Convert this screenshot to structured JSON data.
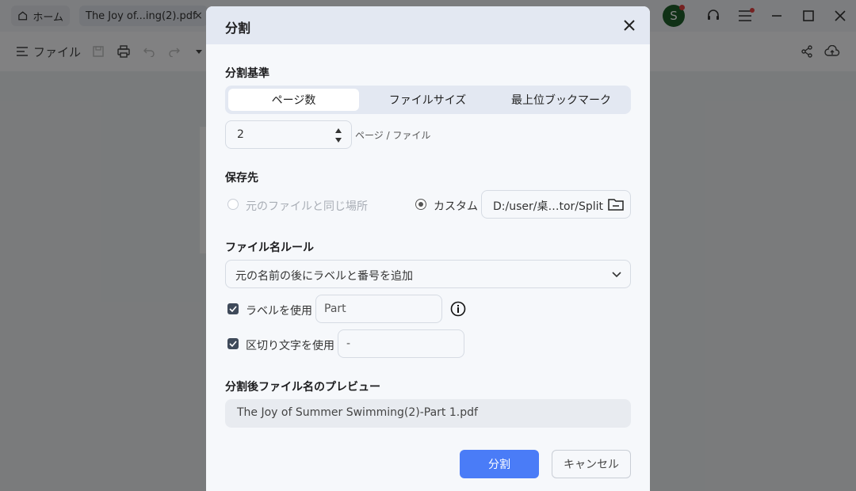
{
  "app": {
    "tabs": [
      {
        "label": "ホーム",
        "icon": "home-icon"
      },
      {
        "label": "The Joy of...ing(2).pdf",
        "icon": "close-icon"
      }
    ],
    "avatar_letter": "S",
    "toolbar": {
      "file_label": "ファイル"
    },
    "colors": {
      "avatar": "#1f5f2b",
      "notification": "#e04040"
    }
  },
  "dialog": {
    "title": "分割",
    "split_criteria": {
      "label": "分割基準",
      "options": [
        "ページ数",
        "ファイルサイズ",
        "最上位ブックマーク"
      ],
      "selected": "ページ数",
      "pages_value": "2",
      "unit_label": "ページ / ファイル"
    },
    "save_location": {
      "label": "保存先",
      "option_same": "元のファイルと同じ場所",
      "option_custom": "カスタム",
      "selected": "カスタム",
      "path": "D:/user/桌…tor/Split"
    },
    "filename_rule": {
      "label": "ファイル名ルール",
      "selected": "元の名前の後にラベルと番号を追加",
      "use_label": {
        "text": "ラベルを使用",
        "checked": true,
        "value": "Part"
      },
      "use_separator": {
        "text": "区切り文字を使用",
        "checked": true,
        "value": "-"
      }
    },
    "preview": {
      "label": "分割後ファイル名のプレビュー",
      "value": "The Joy of Summer Swimming(2)-Part 1.pdf"
    },
    "buttons": {
      "primary": "分割",
      "cancel": "キャンセル"
    },
    "colors": {
      "primary": "#4a7cf7",
      "header": "#e3e8f2"
    }
  }
}
